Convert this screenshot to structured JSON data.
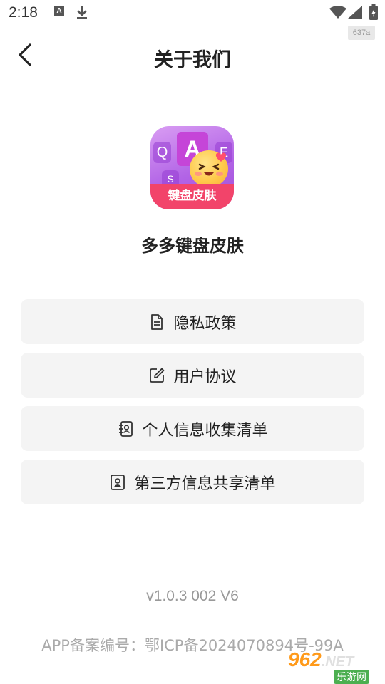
{
  "status_bar": {
    "time": "2:18",
    "font_icon_letter": "A",
    "badge": "637a"
  },
  "header": {
    "title": "关于我们",
    "back_icon": "chevron-left-icon"
  },
  "app": {
    "logo_keys": [
      "Q",
      "A",
      "E",
      "S"
    ],
    "logo_banner": "键盘皮肤",
    "name": "多多键盘皮肤"
  },
  "menu": [
    {
      "label": "隐私政策",
      "icon": "document-icon"
    },
    {
      "label": "用户协议",
      "icon": "edit-icon"
    },
    {
      "label": "个人信息收集清单",
      "icon": "contact-book-icon"
    },
    {
      "label": "第三方信息共享清单",
      "icon": "id-card-icon"
    }
  ],
  "footer": {
    "version": "v1.0.3 002 V6",
    "record": "APP备案编号：鄂ICP备2024070894号-99A"
  },
  "watermark": {
    "brand": "962",
    "brand_suffix": ".NET",
    "sub": "乐游网"
  },
  "colors": {
    "accent_pink": "#f2446a",
    "logo_purple": "#b264e6",
    "menu_bg": "#f4f4f4"
  }
}
